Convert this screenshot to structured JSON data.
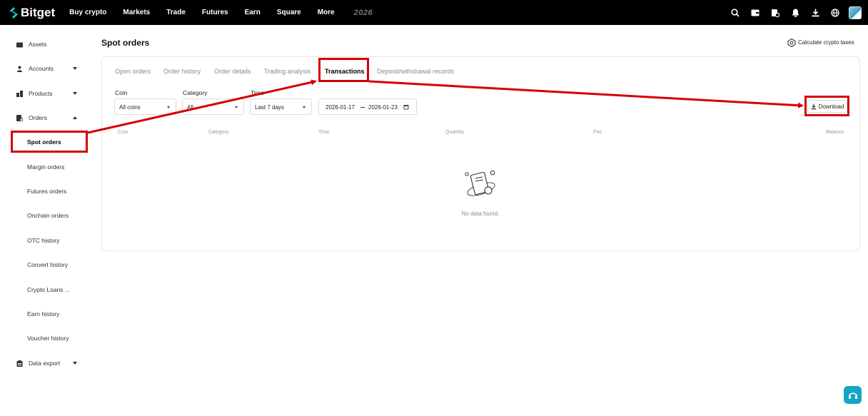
{
  "brand": {
    "name": "Bitget",
    "accent": "#1fc7d4"
  },
  "topnav": {
    "items": [
      "Buy crypto",
      "Markets",
      "Trade",
      "Futures",
      "Earn",
      "Square",
      "More"
    ],
    "badge": "2026"
  },
  "sidebar": {
    "items": [
      {
        "label": "Assets",
        "icon": "wallet-icon"
      },
      {
        "label": "Accounts",
        "icon": "user-icon"
      },
      {
        "label": "Products",
        "icon": "products-icon"
      },
      {
        "label": "Orders",
        "icon": "orders-icon"
      }
    ],
    "orders_sub": [
      "Spot orders",
      "Margin orders",
      "Futures orders",
      "Onchain orders",
      "OTC history",
      "Convert history",
      "Crypto Loans ...",
      "Earn history",
      "Voucher history"
    ],
    "data_export": "Data export",
    "active": "Spot orders"
  },
  "main": {
    "title": "Spot orders",
    "tax_button": "Calculate crypto taxes",
    "tabs": [
      "Open orders",
      "Order history",
      "Order details",
      "Trading analysis",
      "Transactions",
      "Deposit/withdrawal records"
    ],
    "active_tab": "Transactions",
    "filters": {
      "coin_label": "Coin",
      "coin_value": "All coins",
      "category_label": "Category",
      "category_value": "All",
      "time_label": "Time",
      "time_value": "Last 7 days",
      "date_start": "2026-01-17",
      "date_end": "2026-01-23"
    },
    "download_label": "Download",
    "columns": [
      "Coin",
      "Category",
      "Time",
      "Quantity",
      "Fee",
      "Balance"
    ],
    "empty_text": "No data found."
  },
  "annotation_color": "#d40000"
}
